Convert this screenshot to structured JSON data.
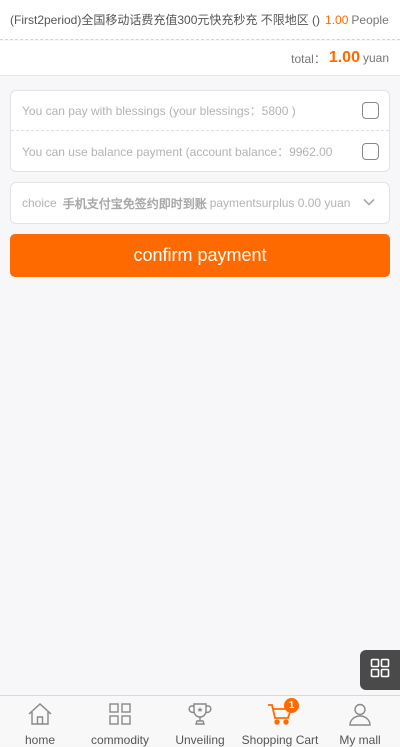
{
  "order": {
    "item_name": "(First2period)全国移动话费充值300元快充秒充 不限地区 ()",
    "price": "1.00",
    "unit": "People"
  },
  "total": {
    "label": "total：",
    "amount": "1.00",
    "currency": "yuan"
  },
  "payment_options": {
    "blessings_label": "You can pay with blessings (your blessings：5800 )",
    "balance_label": "You can use balance payment (account balance：9962.00"
  },
  "payment_method": {
    "prefix": "choice",
    "method": "手机支付宝免签约即时到账",
    "suffix": "paymentsurplus 0.00 yuan"
  },
  "confirm_button": "confirm payment",
  "tabbar": {
    "items": [
      {
        "label": "home",
        "icon": "home-icon"
      },
      {
        "label": "commodity",
        "icon": "grid-icon"
      },
      {
        "label": "Unveiling",
        "icon": "trophy-icon"
      },
      {
        "label": "Shopping Cart",
        "icon": "cart-icon",
        "badge": "1"
      },
      {
        "label": "My mall",
        "icon": "person-icon"
      }
    ]
  },
  "colors": {
    "accent": "#ff6a00",
    "float_button": "#4a4a4a"
  }
}
